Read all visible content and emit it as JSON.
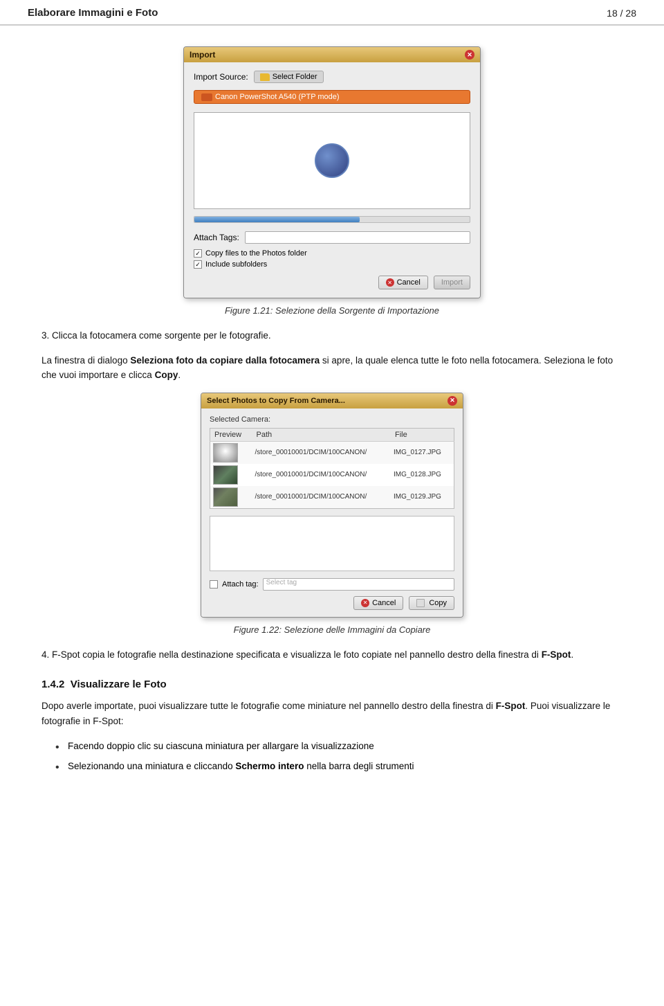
{
  "header": {
    "title": "Elaborare Immagini e Foto",
    "page_number": "18 / 28"
  },
  "figure1": {
    "caption": "Figure 1.21: Selezione della Sorgente di Importazione",
    "dialog": {
      "title": "Import",
      "import_source_label": "Import Source:",
      "select_folder_label": "Select Folder",
      "camera_option": "Canon PowerShot A540 (PTP mode)",
      "attach_tags_label": "Attach Tags:",
      "copy_files_label": "Copy files to the Photos folder",
      "include_subfolders_label": "Include subfolders",
      "cancel_label": "Cancel",
      "import_label": "Import"
    }
  },
  "paragraph1": "3. Clicca la fotocamera come sorgente per le fotografie.",
  "paragraph2": "La finestra di dialogo Seleziona foto da copiare dalla fotocamera si apre, la quale elenca tutte le foto nella fotocamera. Seleziona le foto che vuoi importare e clicca Copy.",
  "figure2": {
    "caption": "Figure 1.22: Selezione delle Immagini da Copiare",
    "dialog": {
      "title": "Select Photos to Copy From Camera...",
      "selected_camera_label": "Selected Camera:",
      "col_preview": "Preview",
      "col_path": "Path",
      "col_file": "File",
      "rows": [
        {
          "path": "/store_00010001/DCIM/100CANON/",
          "file": "IMG_0127.JPG"
        },
        {
          "path": "/store_00010001/DCIM/100CANON/",
          "file": "IMG_0128.JPG"
        },
        {
          "path": "/store_00010001/DCIM/100CANON/",
          "file": "IMG_0129.JPG"
        }
      ],
      "attach_tag_label": "Attach tag:",
      "select_tag_placeholder": "Select tag",
      "cancel_label": "Cancel",
      "copy_label": "Copy"
    }
  },
  "paragraph3": "4. F-Spot copia le fotografie nella destinazione specificata e visualizza le foto copiate nel pannello destro della finestra di F-Spot.",
  "section": {
    "number": "1.4.2",
    "title": "Visualizzare le Foto"
  },
  "paragraph4": "Dopo averle importate, puoi visualizzare tutte le fotografie come miniature nel pannello destro della finestra di F-Spot. Puoi visualizzare le fotografie in F-Spot:",
  "bullets": [
    "Facendo doppio clic su ciascuna miniatura per allargare la visualizzazione",
    "Selezionando una miniatura e cliccando Schermo intero nella barra degli strumenti"
  ],
  "bullets_bold": [
    {
      "text": "Selezionando una miniatura e cliccando ",
      "bold": "Schermo intero",
      "rest": " nella barra degli strumenti"
    }
  ]
}
